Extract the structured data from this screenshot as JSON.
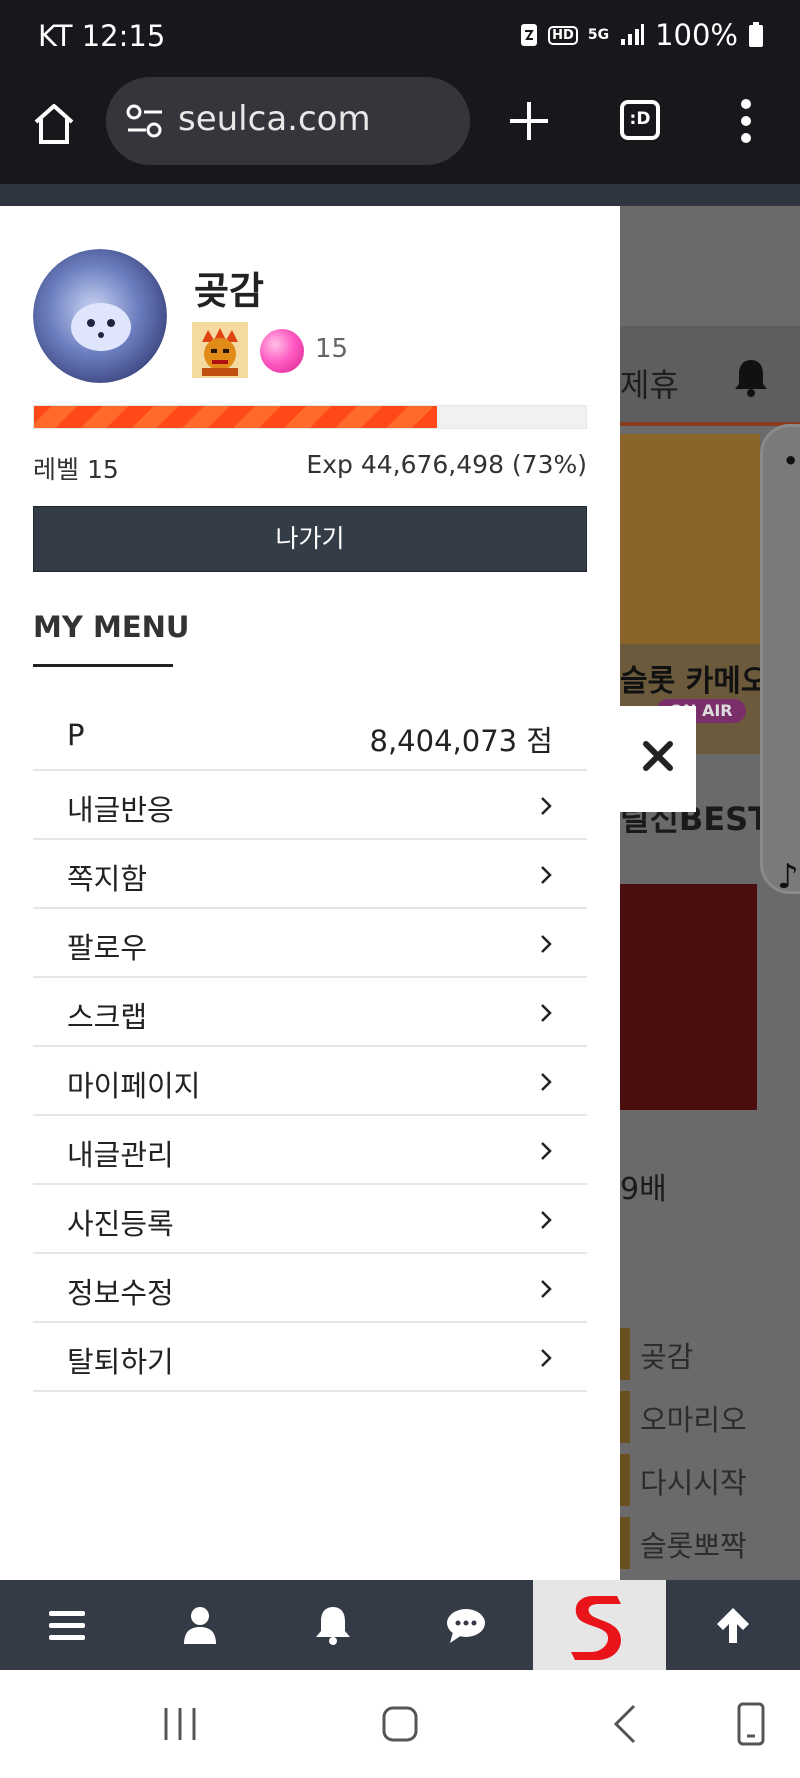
{
  "status_bar": {
    "carrier_time": "KT 12:15",
    "network": "5G",
    "hd": "HD",
    "battery": "100%"
  },
  "browser": {
    "url": "seulca.com",
    "tab_label": ":D"
  },
  "background_page": {
    "nav_text": "제휴",
    "banner_text": "슬롯 카메오",
    "on_air": "ON AIR",
    "best_title": "릴신BEST",
    "promo_text": "9배",
    "ranking": [
      "곶감",
      "오마리오",
      "다시시작",
      "슬롯뽀짝"
    ]
  },
  "drawer": {
    "username": "곶감",
    "level_badge": "15",
    "exp_progress": 0.73,
    "level_label": "레벨 15",
    "exp_label": "Exp 44,676,498 (73%)",
    "logout_label": "나가기",
    "my_menu_title": "MY MENU",
    "points": {
      "label": "P",
      "value": "8,404,073 점"
    },
    "menu_items": [
      "내글반응",
      "쪽지함",
      "팔로우",
      "스크랩",
      "마이페이지",
      "내글관리",
      "사진등록",
      "정보수정",
      "탈퇴하기"
    ]
  },
  "colors": {
    "accent": "#ff4a18",
    "dark": "#343b46",
    "logo_red": "#e8141a"
  }
}
